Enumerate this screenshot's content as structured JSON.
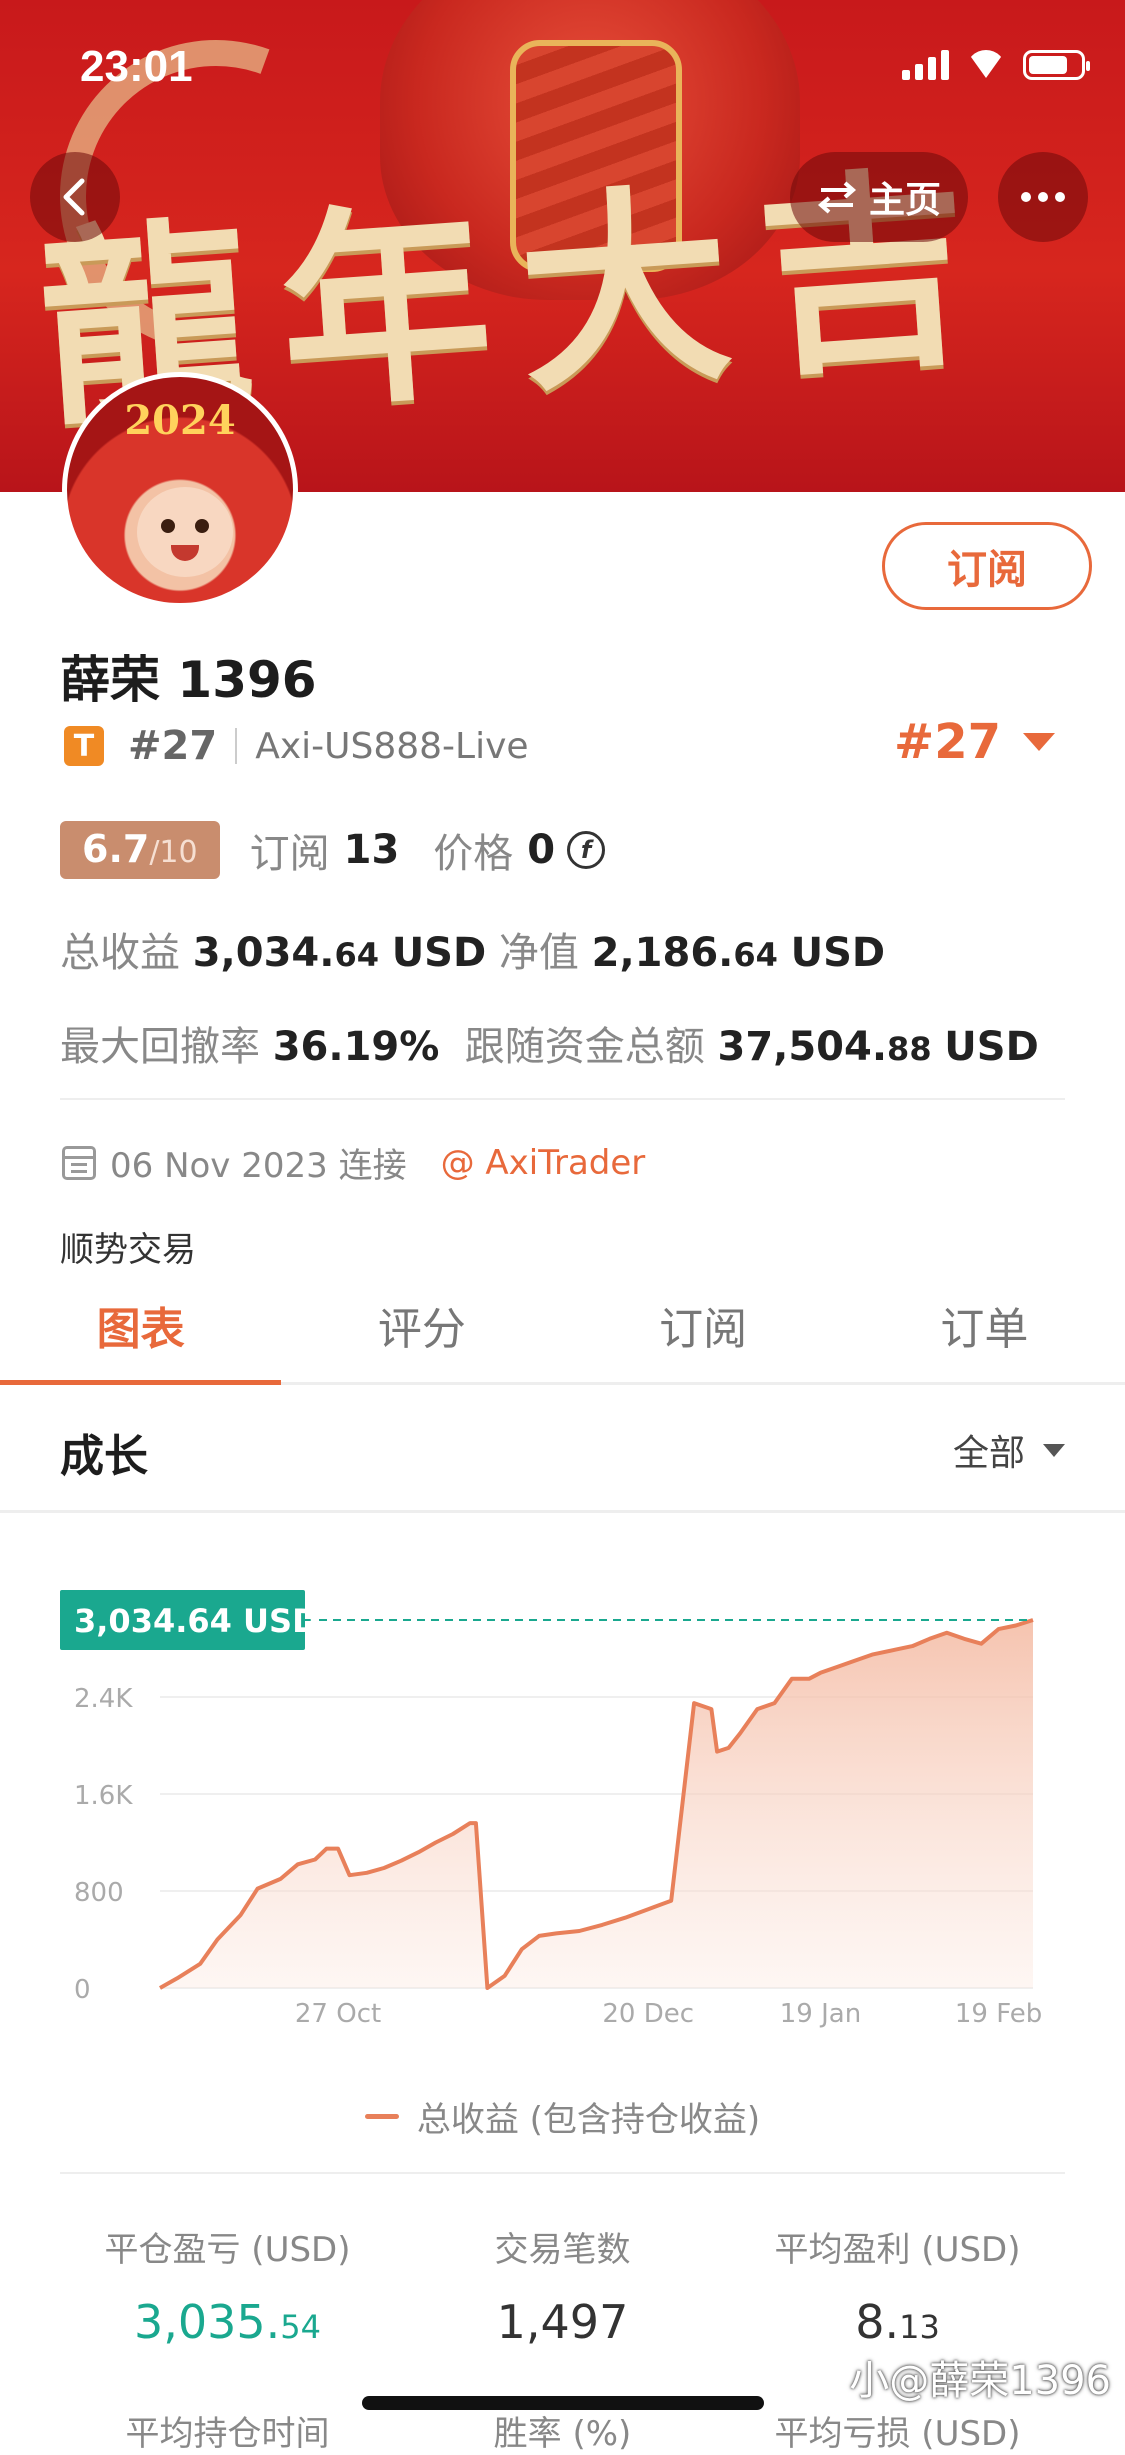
{
  "status_bar": {
    "time": "23:01"
  },
  "nav": {
    "home_label": "主页"
  },
  "banner": {
    "calligraphy": "龍年大吉"
  },
  "avatar": {
    "year_text": "2024"
  },
  "profile": {
    "name": "薛荣 1396",
    "badge": "T",
    "rank": "#27",
    "server": "Axi-US888-Live",
    "rank_highlight": "#27",
    "subscribe_label": "订阅"
  },
  "score": {
    "value": "6.7",
    "max": "/10",
    "subs_label": "订阅",
    "subs_value": "13",
    "price_label": "价格",
    "price_value": "0"
  },
  "stats_lines": {
    "total_profit_label": "总收益",
    "total_profit_main": "3,034.",
    "total_profit_dec": "64",
    "total_profit_unit": "USD",
    "net_label": "净值",
    "net_main": "2,186.",
    "net_dec": "64",
    "net_unit": "USD",
    "drawdown_label": "最大回撤率",
    "drawdown_value": "36.19%",
    "follow_label": "跟随资金总额",
    "follow_main": "37,504.",
    "follow_dec": "88",
    "follow_unit": "USD"
  },
  "connect": {
    "date": "06 Nov 2023 连接",
    "at_link": "@ AxiTrader",
    "strategy": "顺势交易"
  },
  "tabs": [
    "图表",
    "评分",
    "订阅",
    "订单"
  ],
  "section": {
    "title": "成长",
    "filter": "全部"
  },
  "chart_data": {
    "type": "area",
    "series_label": "总收益 (包含持仓收益)",
    "current_label": "3,034.64 USD",
    "y_ticks": [
      "0",
      "800",
      "1.6K",
      "2.4K"
    ],
    "x_ticks": [
      "27 Oct",
      "20 Dec",
      "19 Jan",
      "19 Feb"
    ],
    "ylim": [
      0,
      3200
    ],
    "x": [
      "2023-09-26",
      "2023-09-29",
      "2023-10-03",
      "2023-10-06",
      "2023-10-10",
      "2023-10-13",
      "2023-10-17",
      "2023-10-20",
      "2023-10-23",
      "2023-10-25",
      "2023-10-27",
      "2023-10-29",
      "2023-11-01",
      "2023-11-04",
      "2023-11-07",
      "2023-11-10",
      "2023-11-13",
      "2023-11-16",
      "2023-11-19",
      "2023-11-20",
      "2023-11-22",
      "2023-11-25",
      "2023-11-28",
      "2023-12-01",
      "2023-12-04",
      "2023-12-08",
      "2023-12-12",
      "2023-12-16",
      "2023-12-20",
      "2023-12-24",
      "2023-12-28",
      "2023-12-31",
      "2024-01-01",
      "2024-01-03",
      "2024-01-05",
      "2024-01-08",
      "2024-01-11",
      "2024-01-14",
      "2024-01-17",
      "2024-01-19",
      "2024-01-22",
      "2024-01-25",
      "2024-01-28",
      "2024-02-01",
      "2024-02-04",
      "2024-02-07",
      "2024-02-10",
      "2024-02-13",
      "2024-02-16",
      "2024-02-19",
      "2024-02-22",
      "2024-02-25"
    ],
    "y": [
      0,
      80,
      200,
      400,
      600,
      820,
      900,
      1020,
      1060,
      1150,
      1150,
      930,
      950,
      990,
      1050,
      1120,
      1200,
      1270,
      1360,
      1360,
      0,
      100,
      320,
      430,
      450,
      470,
      520,
      580,
      650,
      720,
      2350,
      2300,
      1950,
      1980,
      2100,
      2300,
      2350,
      2550,
      2550,
      2600,
      2650,
      2700,
      2750,
      2790,
      2820,
      2880,
      2930,
      2880,
      2840,
      2960,
      2990,
      3034.64
    ]
  },
  "summary": {
    "col1_label": "平仓盈亏 (USD)",
    "col1_main": "3,035.",
    "col1_dec": "54",
    "col2_label": "交易笔数",
    "col2_value": "1,497",
    "col3_label": "平均盈利 (USD)",
    "col3_main": "8.",
    "col3_dec": "13",
    "row2_col1": "平均持仓时间",
    "row2_col2": "胜率 (%)",
    "row2_col3": "平均亏损 (USD)"
  },
  "watermark": "小@薛荣1396",
  "colors": {
    "accent": "#e8693b",
    "teal": "#1aa88f",
    "banner_red": "#d7261e"
  }
}
